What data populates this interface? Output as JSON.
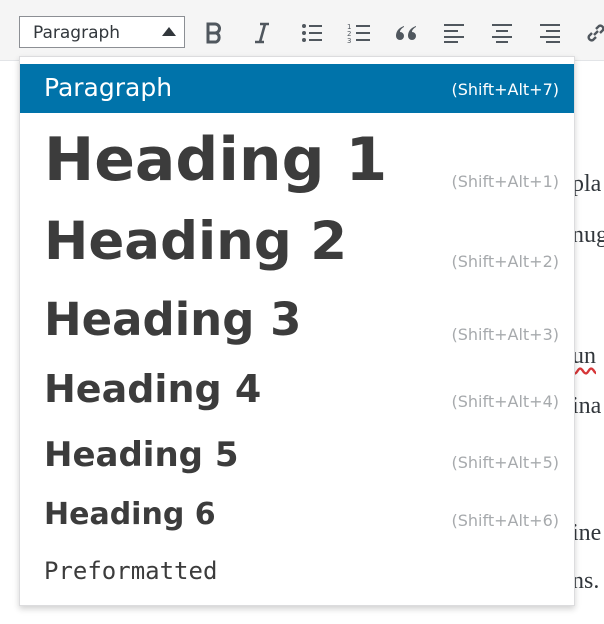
{
  "toolbar": {
    "format_select": {
      "value": "Paragraph"
    },
    "buttons": [
      {
        "name": "bold-button",
        "icon": "bold-icon",
        "glyph": "B"
      },
      {
        "name": "italic-button",
        "icon": "italic-icon",
        "glyph": "I"
      },
      {
        "name": "bulleted-list-button",
        "icon": "bulleted-list-icon"
      },
      {
        "name": "numbered-list-button",
        "icon": "numbered-list-icon"
      },
      {
        "name": "blockquote-button",
        "icon": "blockquote-icon"
      },
      {
        "name": "align-left-button",
        "icon": "align-left-icon"
      },
      {
        "name": "align-center-button",
        "icon": "align-center-icon"
      },
      {
        "name": "align-right-button",
        "icon": "align-right-icon"
      },
      {
        "name": "link-button",
        "icon": "link-icon"
      }
    ]
  },
  "dropdown": {
    "selected_index": 0,
    "items": [
      {
        "label": "Paragraph",
        "shortcut": "(Shift+Alt+7)"
      },
      {
        "label": "Heading 1",
        "shortcut": "(Shift+Alt+1)"
      },
      {
        "label": "Heading 2",
        "shortcut": "(Shift+Alt+2)"
      },
      {
        "label": "Heading 3",
        "shortcut": "(Shift+Alt+3)"
      },
      {
        "label": "Heading 4",
        "shortcut": "(Shift+Alt+4)"
      },
      {
        "label": "Heading 5",
        "shortcut": "(Shift+Alt+5)"
      },
      {
        "label": "Heading 6",
        "shortcut": "(Shift+Alt+6)"
      },
      {
        "label": "Preformatted",
        "shortcut": ""
      }
    ]
  },
  "editor": {
    "visible_fragments": [
      "pla",
      "nug",
      "un",
      "ina",
      "ine",
      "ns."
    ]
  },
  "colors": {
    "selected_bg": "#0073aa",
    "selected_text": "#ffffff",
    "item_text": "#3c3c3c",
    "shortcut_text": "#a7aaad"
  }
}
